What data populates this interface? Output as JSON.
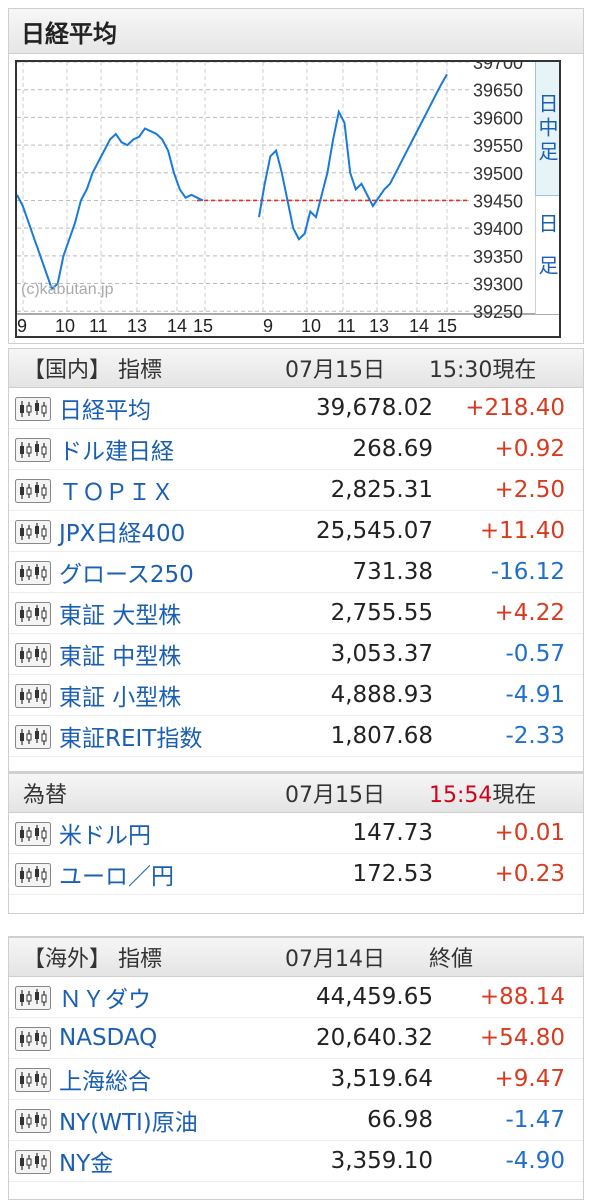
{
  "title": "日経平均",
  "chart": {
    "watermark": "(c)kabutan.jp",
    "y_ticks": [
      "39700",
      "39650",
      "39600",
      "39550",
      "39500",
      "39450",
      "39400",
      "39350",
      "39300",
      "39250"
    ],
    "x_ticks": [
      "9",
      "10",
      "11",
      "13",
      "14",
      "15",
      "9",
      "10",
      "11",
      "13",
      "14",
      "15"
    ],
    "side_tabs": [
      "日中足",
      "日足"
    ]
  },
  "chart_data": {
    "type": "line",
    "title": "日経平均",
    "ylim": [
      39245,
      39700
    ],
    "reference_line": 39450,
    "series": [
      {
        "values": [
          39460,
          39440,
          39410,
          39380,
          39350,
          39320,
          39290,
          39300,
          39350,
          39380,
          39410,
          39450,
          39470,
          39500,
          39520,
          39540,
          39560,
          39570,
          39555,
          39550,
          39560,
          39565,
          39580,
          39575,
          39570,
          39560,
          39540,
          39500,
          39470,
          39455,
          39460,
          39455,
          39450
        ]
      },
      {
        "values": [
          39420,
          39480,
          39530,
          39540,
          39500,
          39450,
          39400,
          39380,
          39390,
          39430,
          39420,
          39460,
          39500,
          39560,
          39610,
          39590,
          39500,
          39470,
          39480,
          39460,
          39440,
          39455,
          39470,
          39480,
          39500,
          39520,
          39540,
          39560,
          39580,
          39600,
          39620,
          39640,
          39660,
          39678
        ]
      }
    ]
  },
  "domestic": {
    "header": {
      "title": "【国内】 指標",
      "date": "07月15日",
      "time": "15:30現在"
    },
    "rows": [
      {
        "name": "日経平均",
        "value": "39,678.02",
        "change": "+218.40",
        "dir": "up"
      },
      {
        "name": "ドル建日経",
        "value": "268.69",
        "change": "+0.92",
        "dir": "up"
      },
      {
        "name": "ＴＯＰＩＸ",
        "value": "2,825.31",
        "change": "+2.50",
        "dir": "up"
      },
      {
        "name": "JPX日経400",
        "value": "25,545.07",
        "change": "+11.40",
        "dir": "up"
      },
      {
        "name": "グロース250",
        "value": "731.38",
        "change": "-16.12",
        "dir": "down"
      },
      {
        "name": "東証 大型株",
        "value": "2,755.55",
        "change": "+4.22",
        "dir": "up"
      },
      {
        "name": "東証 中型株",
        "value": "3,053.37",
        "change": "-0.57",
        "dir": "down"
      },
      {
        "name": "東証 小型株",
        "value": "4,888.93",
        "change": "-4.91",
        "dir": "down"
      },
      {
        "name": "東証REIT指数",
        "value": "1,807.68",
        "change": "-2.33",
        "dir": "down"
      }
    ]
  },
  "fx": {
    "header": {
      "title": "為替",
      "date": "07月15日",
      "time_red": "15:54",
      "time_suffix": "現在"
    },
    "rows": [
      {
        "name": "米ドル円",
        "value": "147.73",
        "change": "+0.01",
        "dir": "up"
      },
      {
        "name": "ユーロ／円",
        "value": "172.53",
        "change": "+0.23",
        "dir": "up"
      }
    ]
  },
  "overseas": {
    "header": {
      "title": "【海外】 指標",
      "date": "07月14日",
      "time": "終値"
    },
    "rows": [
      {
        "name": "ＮＹダウ",
        "value": "44,459.65",
        "change": "+88.14",
        "dir": "up"
      },
      {
        "name": "NASDAQ",
        "value": "20,640.32",
        "change": "+54.80",
        "dir": "up"
      },
      {
        "name": "上海総合",
        "value": "3,519.64",
        "change": "+9.47",
        "dir": "up"
      },
      {
        "name": "NY(WTI)原油",
        "value": "66.98",
        "change": "-1.47",
        "dir": "down"
      },
      {
        "name": "NY金",
        "value": "3,359.10",
        "change": "-4.90",
        "dir": "down"
      }
    ]
  },
  "colors": {
    "up": "#d83a1f",
    "down": "#1f6fc9",
    "line": "#1a7ad9",
    "ref": "#e0301e",
    "name": "#1a5fb4"
  },
  "icon": "candlestick-chart-icon"
}
